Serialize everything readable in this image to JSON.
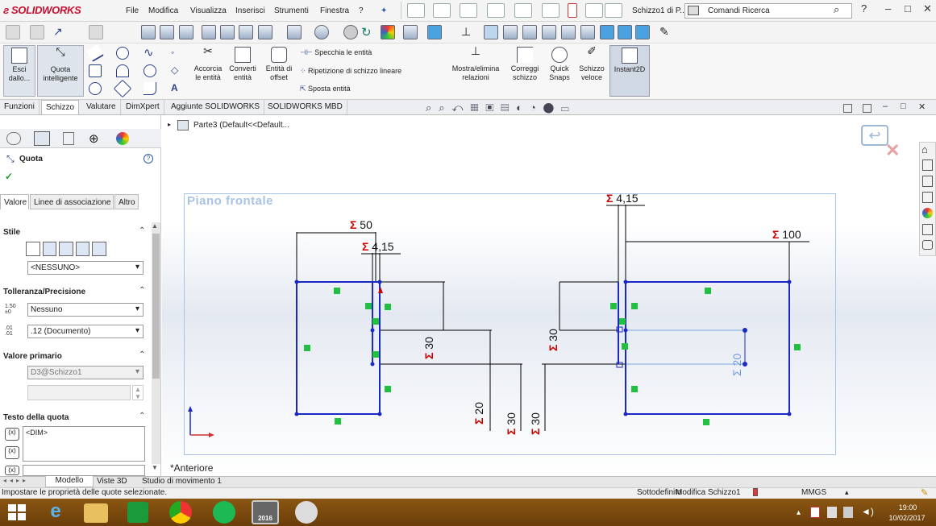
{
  "app": {
    "logo": "SOLIDWORKS",
    "doc_title": "Schizzo1 di P...",
    "search_placeholder": "Comandi Ricerca"
  },
  "menu": [
    "File",
    "Modifica",
    "Visualizza",
    "Inserisci",
    "Strumenti",
    "Finestra",
    "?"
  ],
  "commands": {
    "exit_sketch": "Esci\ndallo...",
    "smart_dim": "Quota\nintelligente",
    "trim": "Accorcia\nle entità",
    "convert": "Converti\nentità",
    "offset": "Entità di\noffset",
    "mirror": "Specchia le entità",
    "linear_pattern": "Ripetizione di schizzo lineare",
    "move": "Sposta entità",
    "display_relations": "Mostra/elimina\nrelazioni",
    "repair": "Correggi\nschizzo",
    "quick_snaps": "Quick\nSnaps",
    "rapid_sketch": "Schizzo\nveloce",
    "instant2d": "Instant2D"
  },
  "tabs": [
    "Funzioni",
    "Schizzo",
    "Valutare",
    "DimXpert",
    "Aggiunte SOLIDWORKS",
    "SOLIDWORKS MBD"
  ],
  "active_tab": "Schizzo",
  "tree": {
    "item": "Parte3 (Default<<Default..."
  },
  "panel": {
    "title": "Quota",
    "subtabs": [
      "Valore",
      "Linee di associazione",
      "Altro"
    ],
    "style_label": "Stile",
    "style_value": "<NESSUNO>",
    "tol_label": "Tolleranza/Precisione",
    "tol_value": "Nessuno",
    "precision_value": ".12 (Documento)",
    "primary_label": "Valore primario",
    "primary_value": "D3@Schizzo1",
    "text_label": "Testo della quota",
    "text_value": "<DIM>"
  },
  "view": {
    "plane": "Piano frontale",
    "orientation": "*Anteriore"
  },
  "dimensions": [
    {
      "name": "d50",
      "text": "50"
    },
    {
      "name": "d415-left",
      "text": "4,15"
    },
    {
      "name": "d415-right",
      "text": "4,15"
    },
    {
      "name": "d100",
      "text": "100"
    },
    {
      "name": "d30-a",
      "text": "30"
    },
    {
      "name": "d30-b",
      "text": "30"
    },
    {
      "name": "d20-a",
      "text": "20"
    },
    {
      "name": "d30-c",
      "text": "30"
    },
    {
      "name": "d30-d",
      "text": "30"
    },
    {
      "name": "d20-active",
      "text": "20"
    }
  ],
  "bottom_tabs": [
    "Modello",
    "Viste 3D",
    "Studio di movimento 1"
  ],
  "status": {
    "hint": "Impostare le proprietà delle quote selezionate.",
    "state": "Sottodefinito",
    "mode": "Modifica Schizzo1",
    "units": "MMGS"
  },
  "taskbar": {
    "time": "19:00",
    "date": "10/02/2017",
    "sw_badge": "2016"
  },
  "colors": {
    "sketch_blue": "#1b28c8",
    "dim_red": "#d00000",
    "relation_green": "#22c040",
    "brand_red": "#c8102e"
  }
}
